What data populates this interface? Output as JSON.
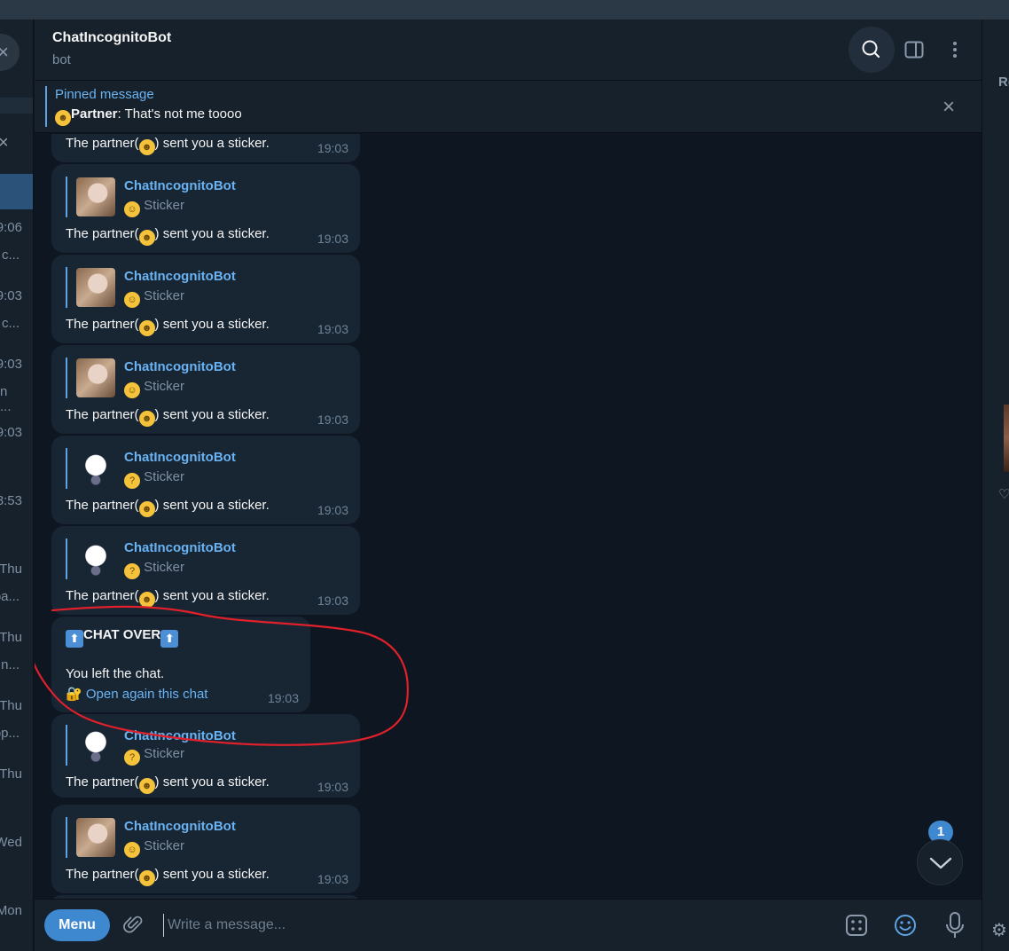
{
  "header": {
    "title": "ChatIncognitoBot",
    "subtitle": "bot"
  },
  "pinned": {
    "label": "Pinned message",
    "sender": "Partner",
    "text": ": That's not me toooo",
    "close": "×"
  },
  "sidebar_left": {
    "times": [
      "9:06",
      "9:03",
      "9:03",
      "9:03",
      "8:53",
      "Thu",
      "Thu",
      "Thu",
      "Thu",
      "Wed",
      "Mon"
    ],
    "snippets": [
      "c...",
      "c...",
      "n ...",
      "pa...",
      "n...",
      "op..."
    ]
  },
  "sidebar_right": {
    "label": "Re",
    "heart": "♡"
  },
  "messages": [
    {
      "type": "text-only",
      "text": "The partner(",
      "text2": ") sent you a sticker.",
      "time": "19:03"
    },
    {
      "type": "sticker",
      "reply_name": "ChatIncognitoBot",
      "reply_sub": "Sticker",
      "reply_emoji": "smile",
      "thumb": "baby",
      "text": "The partner(",
      "text2": ") sent you a sticker.",
      "time": "19:03"
    },
    {
      "type": "sticker",
      "reply_name": "ChatIncognitoBot",
      "reply_sub": "Sticker",
      "reply_emoji": "smile",
      "thumb": "baby",
      "text": "The partner(",
      "text2": ") sent you a sticker.",
      "time": "19:03"
    },
    {
      "type": "sticker",
      "reply_name": "ChatIncognitoBot",
      "reply_sub": "Sticker",
      "reply_emoji": "smile",
      "thumb": "baby",
      "text": "The partner(",
      "text2": ") sent you a sticker.",
      "time": "19:03"
    },
    {
      "type": "sticker",
      "reply_name": "ChatIncognitoBot",
      "reply_sub": "Sticker",
      "reply_emoji": "thinking",
      "thumb": "cat",
      "text": "The partner(",
      "text2": ") sent you a sticker.",
      "time": "19:03"
    },
    {
      "type": "sticker",
      "reply_name": "ChatIncognitoBot",
      "reply_sub": "Sticker",
      "reply_emoji": "thinking",
      "thumb": "cat",
      "text": "The partner(",
      "text2": ") sent you a sticker.",
      "time": "19:03"
    },
    {
      "type": "sticker",
      "reply_name": "ChatIncognitoBot",
      "reply_sub": "Sticker",
      "reply_emoji": "thinking",
      "thumb": "cat",
      "text": "The partner(",
      "text2": ") sent you a sticker.",
      "time": "19:03"
    },
    {
      "type": "sticker",
      "reply_name": "ChatIncognitoBot",
      "reply_sub": "Sticker",
      "reply_emoji": "smile",
      "thumb": "baby",
      "text": "The partner(",
      "text2": ") sent you a sticker.",
      "time": "19:03"
    }
  ],
  "chat_over": {
    "title": "CHAT OVER",
    "line1": "You left the chat.",
    "link": "Open again this chat",
    "time": "19:03"
  },
  "scroll_badge": "1",
  "input": {
    "menu_label": "Menu",
    "placeholder": "Write a message..."
  },
  "colors": {
    "accent": "#3e88d0",
    "link": "#6ab3f3",
    "bubble": "#182533",
    "background": "#0e1621",
    "annotation": "#e0202a"
  }
}
